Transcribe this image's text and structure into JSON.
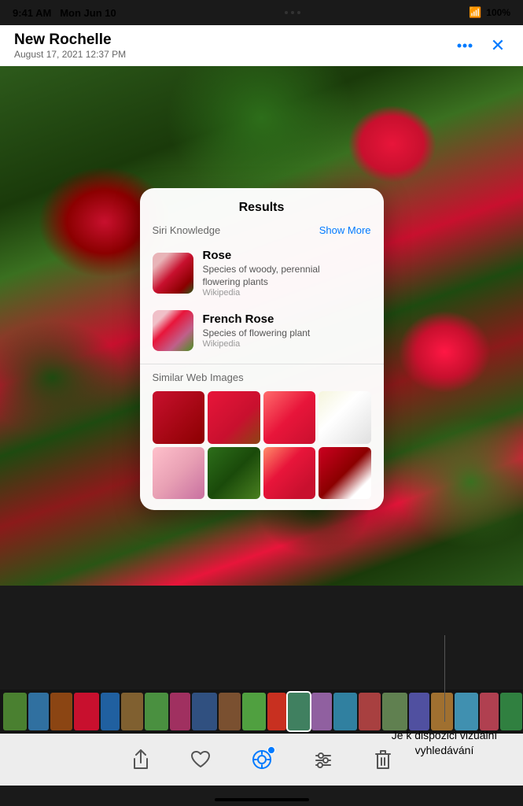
{
  "status_bar": {
    "time": "9:41 AM",
    "date": "Mon Jun 10",
    "battery": "100%",
    "wifi": "●●●"
  },
  "header": {
    "title": "New Rochelle",
    "subtitle": "August 17, 2021  12:37 PM",
    "more_btn_label": "...",
    "close_btn_label": "×"
  },
  "results_panel": {
    "title": "Results",
    "siri_knowledge_label": "Siri Knowledge",
    "show_more_label": "Show More",
    "items": [
      {
        "name": "Rose",
        "desc": "Species of woody, perennial\nflowering plants",
        "source": "Wikipedia"
      },
      {
        "name": "French Rose",
        "desc": "Species of flowering plant",
        "source": "Wikipedia"
      }
    ],
    "similar_images_label": "Similar Web Images"
  },
  "toolbar": {
    "share_label": "Share",
    "heart_label": "Favorite",
    "visual_search_label": "Visual Search",
    "adjust_label": "Adjust",
    "delete_label": "Delete"
  },
  "tooltip": {
    "text": "Je k dispozici vizuální\nvyhledávání"
  }
}
